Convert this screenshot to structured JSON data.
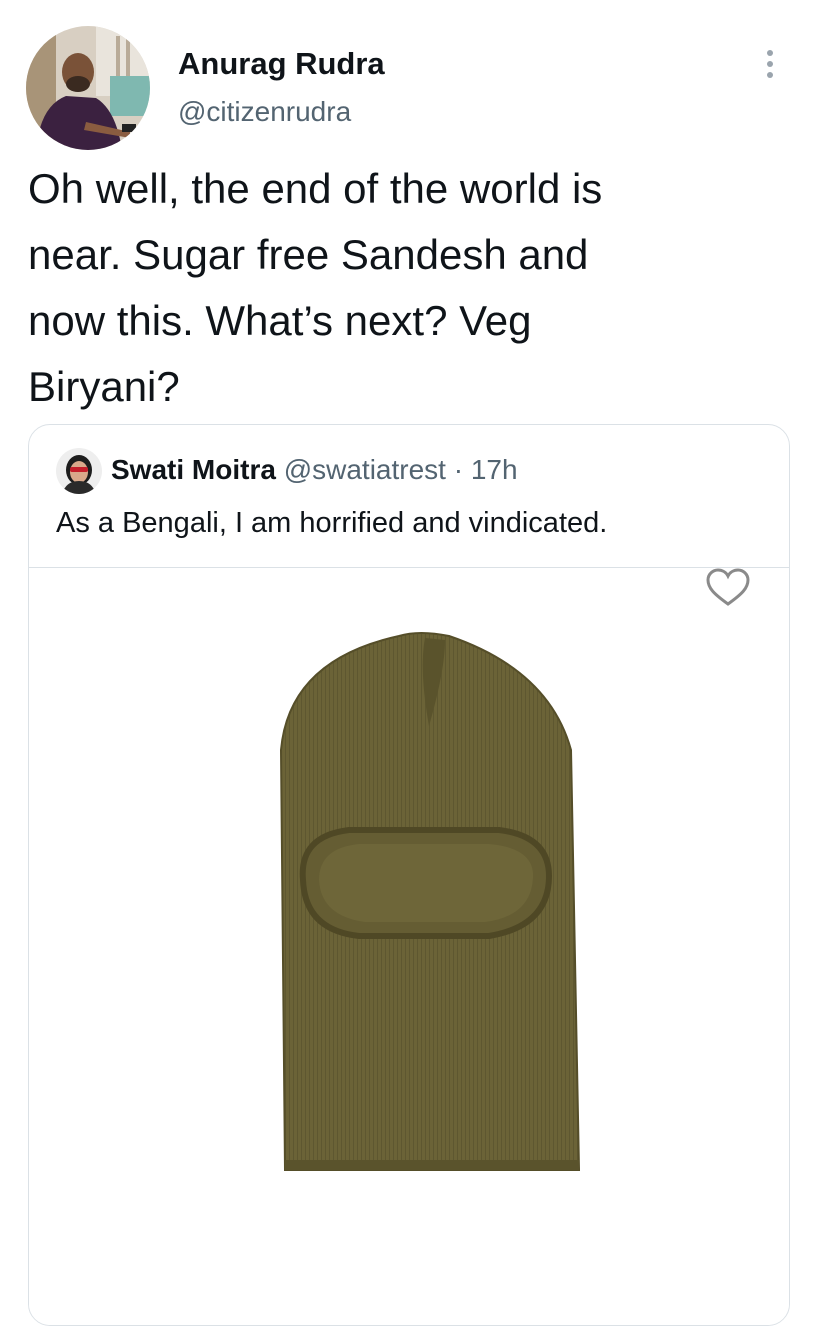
{
  "tweet": {
    "author": {
      "name": "Anurag Rudra",
      "handle": "@citizenrudra",
      "avatar_icon": "profile-photo"
    },
    "more_icon": "more-vertical-icon",
    "text": "Oh well, the end of the world is\nnear. Sugar free Sandesh and\nnow this. What’s next? Veg\nBiryani?"
  },
  "quote": {
    "author": {
      "name": "Swati Moitra",
      "handle": "@swatiatrest",
      "separator": "·",
      "time": "17h",
      "avatar_icon": "profile-photo"
    },
    "text": "As a Bengali, I am horrified and vindicated.",
    "media": {
      "description_icon": "balaclava-image",
      "heart_icon": "heart-outline-icon",
      "colors": {
        "knit": "#6b6337",
        "knit_dark": "#544d28"
      }
    }
  },
  "colors": {
    "text_primary": "#0f1419",
    "text_secondary": "#536471",
    "border": "#dbe1e6"
  }
}
